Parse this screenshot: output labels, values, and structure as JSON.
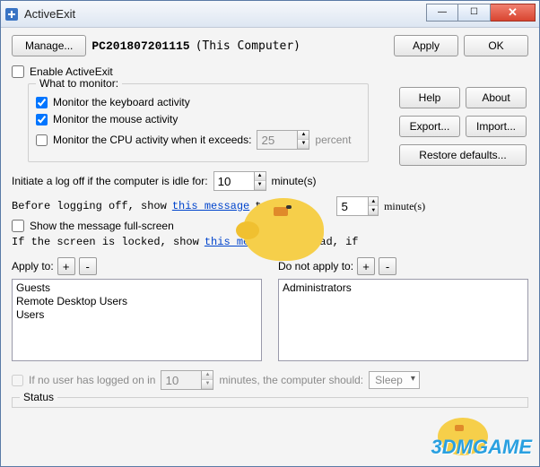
{
  "window": {
    "title": "ActiveExit"
  },
  "toolbar": {
    "manage": "Manage...",
    "computer_name": "PC201807201115",
    "computer_label": "(This Computer)",
    "apply": "Apply",
    "ok": "OK"
  },
  "enable_label": "Enable ActiveExit",
  "monitor": {
    "legend": "What to monitor:",
    "keyboard": "Monitor the keyboard activity",
    "mouse": "Monitor the mouse activity",
    "cpu": "Monitor the CPU activity when it exceeds:",
    "cpu_value": "25",
    "cpu_unit": "percent"
  },
  "side": {
    "help": "Help",
    "about": "About",
    "export": "Export...",
    "import": "Import...",
    "restore": "Restore defaults..."
  },
  "idle": {
    "label": "Initiate a log off if the computer is idle for:",
    "value": "10",
    "unit": "minute(s)"
  },
  "before": {
    "prefix": "Before logging off, show ",
    "link": "this message",
    "mid": " to the",
    "value": "5",
    "unit": "minute(s)"
  },
  "fullscreen_label": "Show the message full-screen",
  "locked": {
    "prefix": "If the screen is locked, show ",
    "link": "this message",
    "suffix": " instead, if"
  },
  "apply_to": {
    "label": "Apply to:",
    "items": [
      "Guests",
      "Remote Desktop Users",
      "Users"
    ]
  },
  "not_apply_to": {
    "label": "Do not apply to:",
    "items": [
      "Administrators"
    ]
  },
  "nouser": {
    "label": "If no user has logged on in",
    "value": "10",
    "mid": "minutes, the computer should:",
    "action": "Sleep"
  },
  "status": {
    "legend": "Status"
  },
  "watermark": "3DMGAME"
}
